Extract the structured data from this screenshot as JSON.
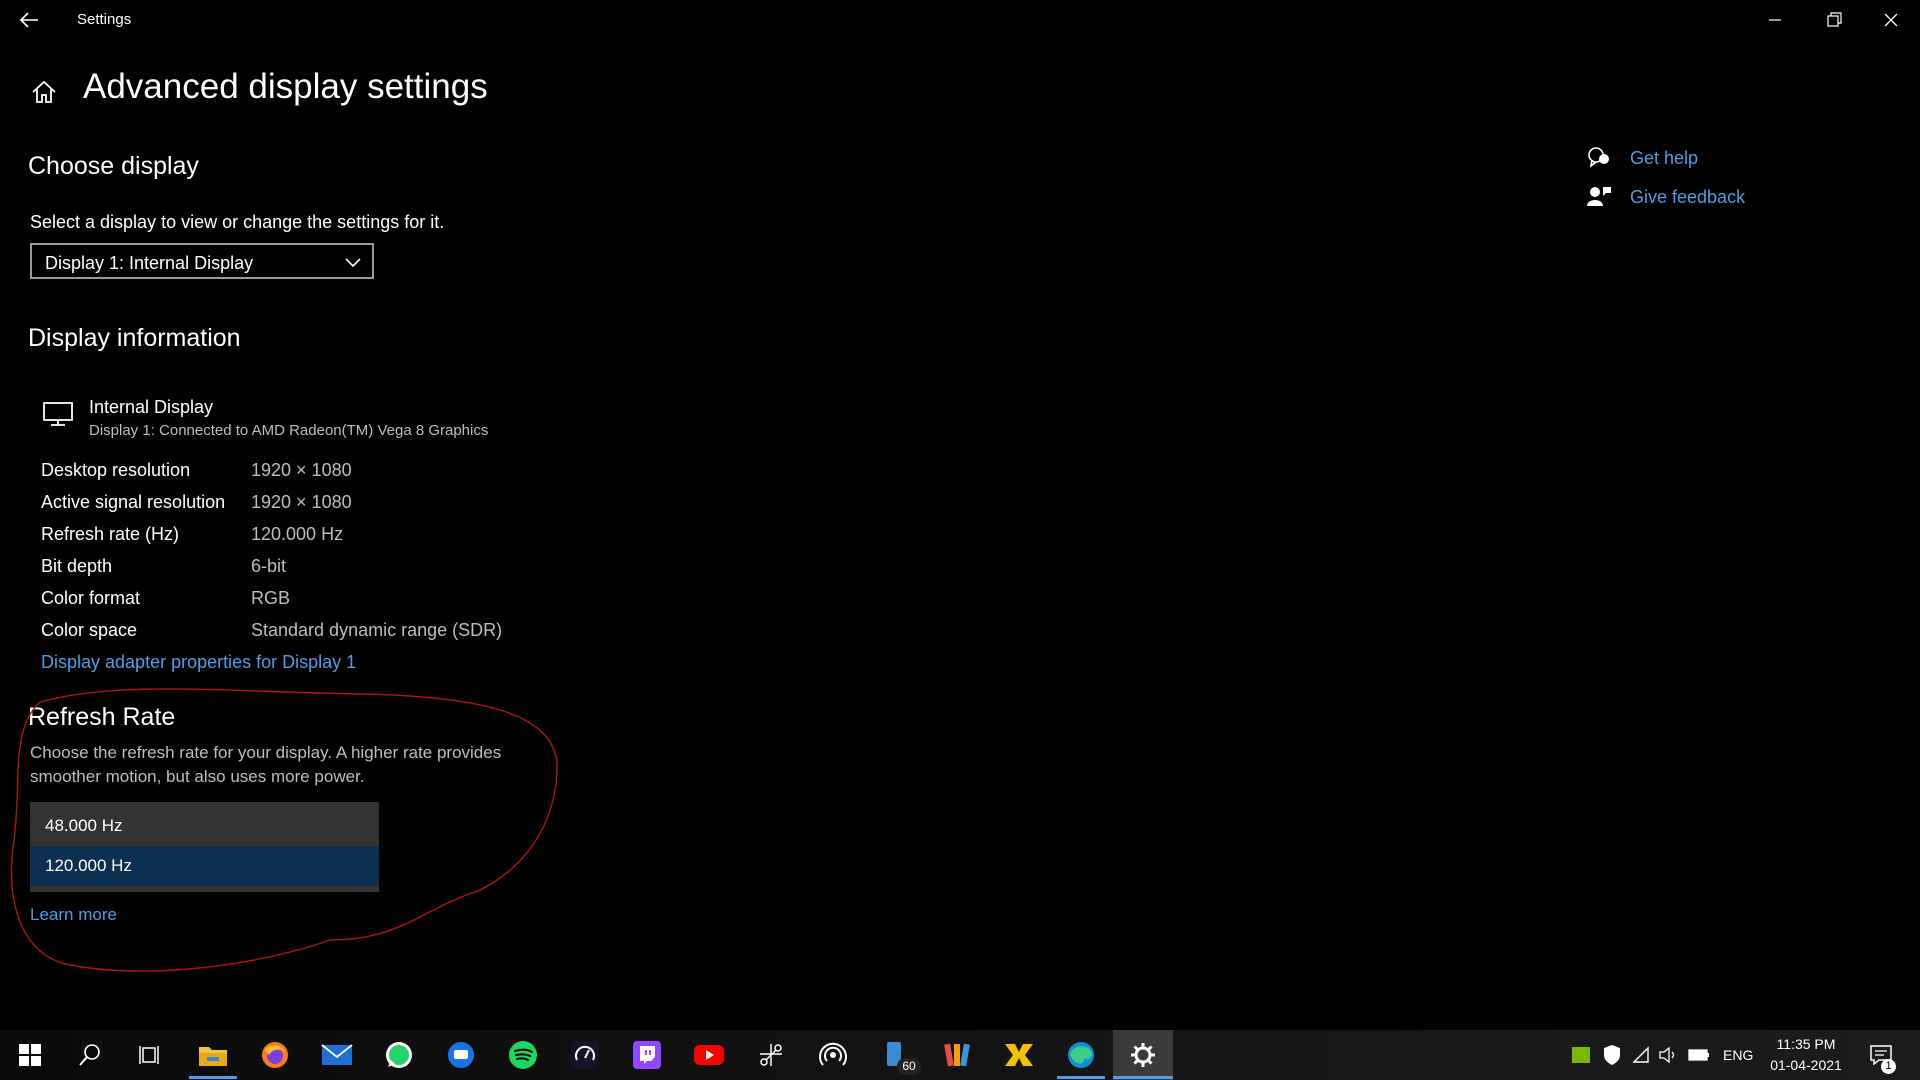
{
  "window": {
    "title": "Settings",
    "controls": [
      "minimize",
      "restore",
      "close"
    ]
  },
  "page": {
    "title": "Advanced display settings"
  },
  "choose_display": {
    "heading": "Choose display",
    "description": "Select a display to view or change the settings for it.",
    "selected": "Display 1: Internal Display"
  },
  "display_info": {
    "heading": "Display information",
    "name": "Internal Display",
    "subtitle": "Display 1: Connected to AMD Radeon(TM) Vega 8 Graphics",
    "rows": [
      {
        "label": "Desktop resolution",
        "value": "1920 × 1080"
      },
      {
        "label": "Active signal resolution",
        "value": "1920 × 1080"
      },
      {
        "label": "Refresh rate (Hz)",
        "value": "120.000 Hz"
      },
      {
        "label": "Bit depth",
        "value": "6-bit"
      },
      {
        "label": "Color format",
        "value": "RGB"
      },
      {
        "label": "Color space",
        "value": "Standard dynamic range (SDR)"
      }
    ],
    "adapter_link": "Display adapter properties for Display 1"
  },
  "refresh_rate": {
    "heading": "Refresh Rate",
    "description_line1": "Choose the refresh rate for your display. A higher rate provides",
    "description_line2": "smoother motion, but also uses more power.",
    "options": [
      "48.000 Hz",
      "120.000 Hz"
    ],
    "selected": "120.000 Hz",
    "learn_more": "Learn more"
  },
  "help": {
    "get_help": "Get help",
    "give_feedback": "Give feedback"
  },
  "taskbar": {
    "apps": [
      "start",
      "search",
      "task-view",
      "file-explorer",
      "firefox",
      "mail",
      "whatsapp",
      "messages",
      "spotify",
      "speedtest",
      "twitch",
      "youtube",
      "network-app",
      "podcast",
      "phone-app",
      "paint",
      "game-app",
      "edge",
      "settings"
    ],
    "badge": "60",
    "language": "ENG",
    "time": "11:35 PM",
    "date": "01-04-2021",
    "notification_count": "1"
  },
  "colors": {
    "background": "#000000",
    "link": "#4a9fe6",
    "selected_option": "#0c3050",
    "annotation": "#b01515"
  }
}
